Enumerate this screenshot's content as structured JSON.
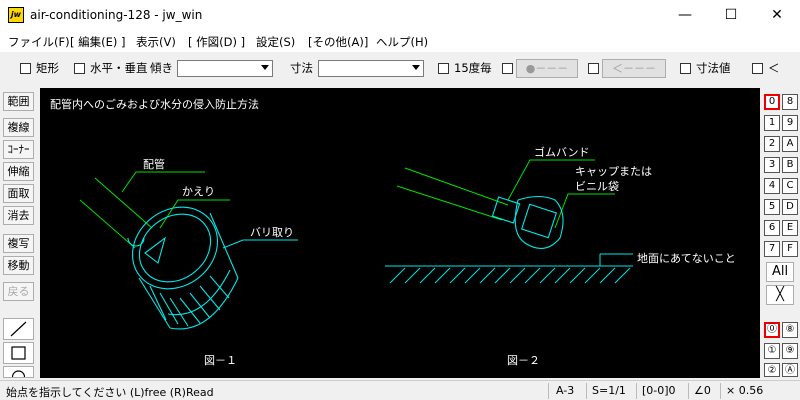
{
  "window": {
    "title": "air-conditioning-128 - jw_win",
    "icon_text": "jw",
    "minimize": "—",
    "maximize": "☐",
    "close": "✕"
  },
  "menu": [
    "ファイル(F)",
    "[ 編集(E) ]",
    "表示(V)",
    "[ 作図(D) ]",
    "設定(S)",
    "[その他(A)]",
    "ヘルプ(H)"
  ],
  "toolbar": {
    "rect_label": "矩形",
    "hv_label": "水平・垂直",
    "tilt_label": "傾き",
    "dim_label": "寸法",
    "deg15_label": "15度毎",
    "dot_btn": "●－－－",
    "arrow_btn": "＜－－－",
    "dimval_label": "寸法値",
    "lt_label": "＜"
  },
  "leftbar": [
    "範囲",
    "複線",
    "ｺｰﾅｰ",
    "伸縮",
    "面取",
    "消去",
    "複写",
    "移動",
    "戻る"
  ],
  "rightbar": {
    "layer_left": [
      "0",
      "1",
      "2",
      "3",
      "4",
      "5",
      "6",
      "7"
    ],
    "layer_right": [
      "8",
      "9",
      "A",
      "B",
      "C",
      "D",
      "E",
      "F"
    ],
    "all_label": "All",
    "x_label": "╳",
    "group_left": [
      "⓪",
      "①",
      "②"
    ],
    "group_right": [
      "⑧",
      "⑨",
      "Ⓐ"
    ]
  },
  "drawing": {
    "title": "配管内へのごみおよび水分の侵入防止方法",
    "label_pipe": "配管",
    "label_kaeri": "かえり",
    "label_bari": "バリ取り",
    "fig1": "図－１",
    "label_gomu": "ゴムバンド",
    "label_cap1": "キャップまたは",
    "label_cap2": "ビニル袋",
    "label_ground": "地面にあてないこと",
    "fig2": "図－２"
  },
  "status": {
    "message": "始点を指示してください (L)free (R)Read",
    "paper": "A-3",
    "scale": "S=1/1",
    "layer": "[0-0]0",
    "angle": "∠0",
    "zoom": "× 0.56"
  },
  "colors": {
    "canvas_bg": "#000000",
    "green_lines": "#00e000",
    "cyan_lines": "#00e8e8",
    "text": "#ffffff"
  }
}
